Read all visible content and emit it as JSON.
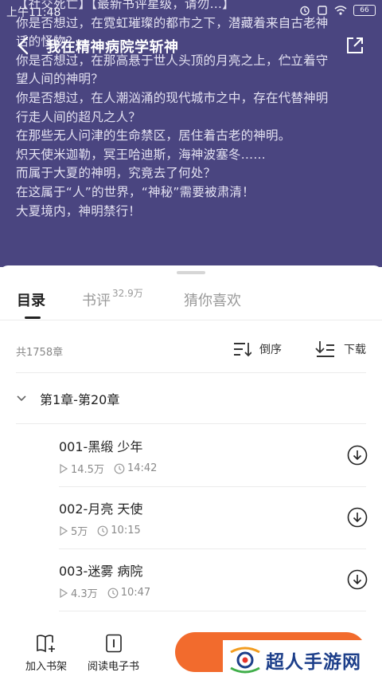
{
  "status": {
    "time": "上午11:48",
    "battery": "66"
  },
  "header": {
    "title": "我在精神病院学斩神"
  },
  "description": [
    "【社交死亡】【最新书评星级，请勿…】",
    "你是否想过，在霓虹璀璨的都市之下，潜藏着来自古老神",
    "话的怪物？",
    "你是否想过，在那高悬于世人头顶的月亮之上，伫立着守",
    "望人间的神明？",
    "你是否想过，在人潮汹涌的现代城市之中，存在代替神明",
    "行走人间的超凡之人？",
    "在那些无人问津的生命禁区，居住着古老的神明。",
    "炽天使米迦勒，冥王哈迪斯，海神波塞冬……",
    "而属于大夏的神明，究竟去了何处？",
    "在这属于“人”的世界，“神秘”需要被肃清！",
    "大夏境内，神明禁行！"
  ],
  "tabs": [
    {
      "label": "目录"
    },
    {
      "label": "书评",
      "badge": "32.9万"
    },
    {
      "label": "猜你喜欢"
    }
  ],
  "toc": {
    "count": "共1758章",
    "sort_label": "倒序",
    "download_label": "下载",
    "section_label": "第1章-第20章"
  },
  "chapters": [
    {
      "title": "001-黑缎 少年",
      "plays": "14.5万",
      "duration": "14:42"
    },
    {
      "title": "002-月亮 天使",
      "plays": "5万",
      "duration": "10:15"
    },
    {
      "title": "003-迷雾 病院",
      "plays": "4.3万",
      "duration": "10:47"
    }
  ],
  "bottom": {
    "add_shelf": "加入书架",
    "read_ebook": "阅读电子书"
  },
  "watermark": "超人手游网",
  "colors": {
    "banner": "#4a4580",
    "accent": "#f26b2d"
  }
}
